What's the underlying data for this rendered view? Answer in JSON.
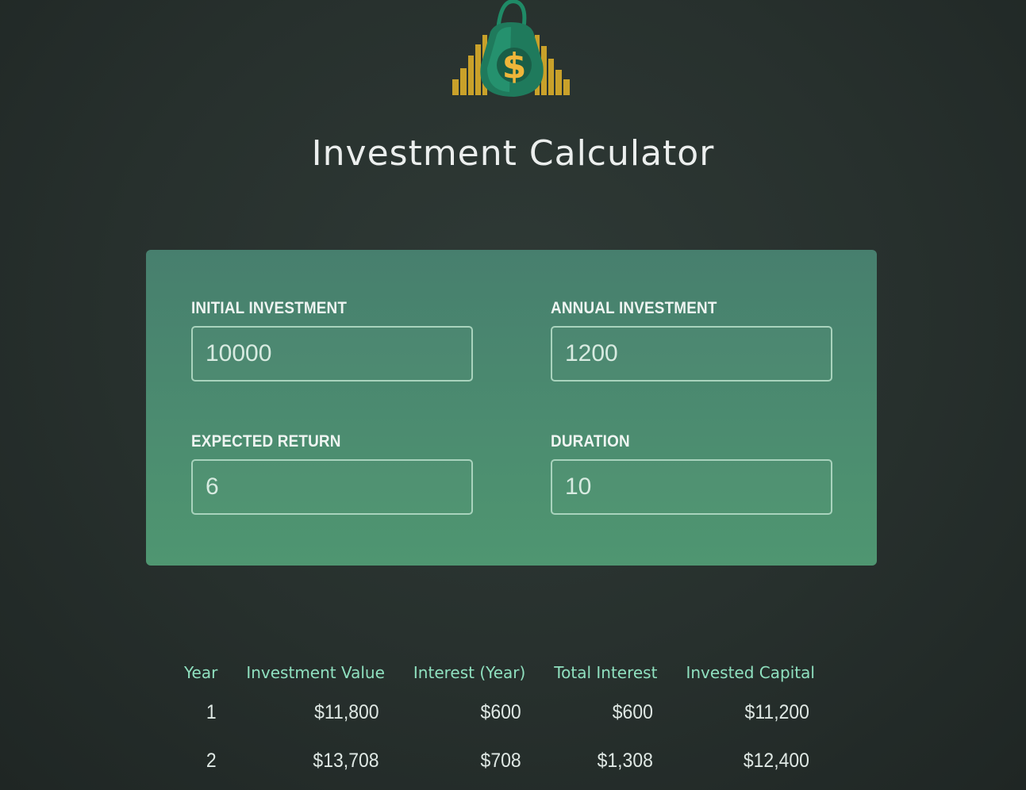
{
  "header": {
    "title": "Investment Calculator",
    "logo_icon": "money-bag-icon"
  },
  "form": {
    "initial_investment": {
      "label": "INITIAL INVESTMENT",
      "value": "10000"
    },
    "annual_investment": {
      "label": "ANNUAL INVESTMENT",
      "value": "1200"
    },
    "expected_return": {
      "label": "EXPECTED RETURN",
      "value": "6"
    },
    "duration": {
      "label": "DURATION",
      "value": "10"
    }
  },
  "results": {
    "columns": [
      "Year",
      "Investment Value",
      "Interest (Year)",
      "Total Interest",
      "Invested Capital"
    ],
    "rows": [
      [
        "1",
        "$11,800",
        "$600",
        "$600",
        "$11,200"
      ],
      [
        "2",
        "$13,708",
        "$708",
        "$1,308",
        "$12,400"
      ]
    ]
  },
  "colors": {
    "background": "#27302d",
    "panel_top": "#477f6e",
    "panel_bottom": "#4f9671",
    "header_accent": "#8fe0bf"
  }
}
